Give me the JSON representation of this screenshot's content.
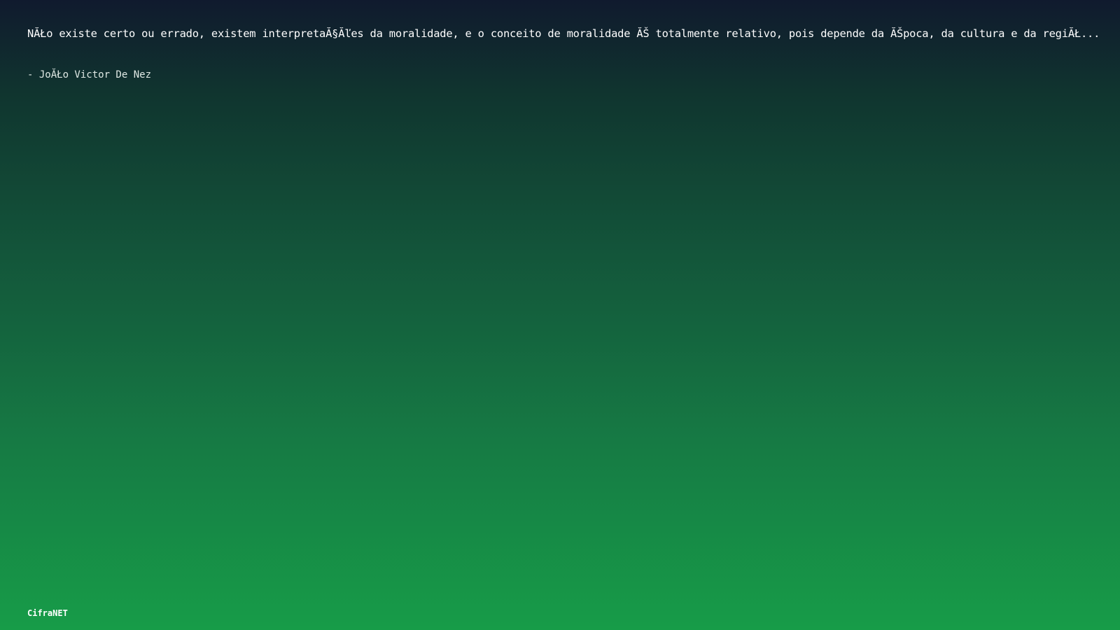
{
  "quote": {
    "text": "NĂŁo existe certo ou errado, existem interpretaĂ§Ăľes da moralidade, e o conceito de moralidade ĂŠ totalmente relativo, pois depende da ĂŠpoca, da cultura e da regiĂŁ...",
    "author": "- JoĂŁo Victor De Nez"
  },
  "footer": {
    "brand": "CifraNET"
  },
  "colors": {
    "gradient_top": "#101a2e",
    "gradient_bottom": "#179c48",
    "text": "#ffffff"
  }
}
